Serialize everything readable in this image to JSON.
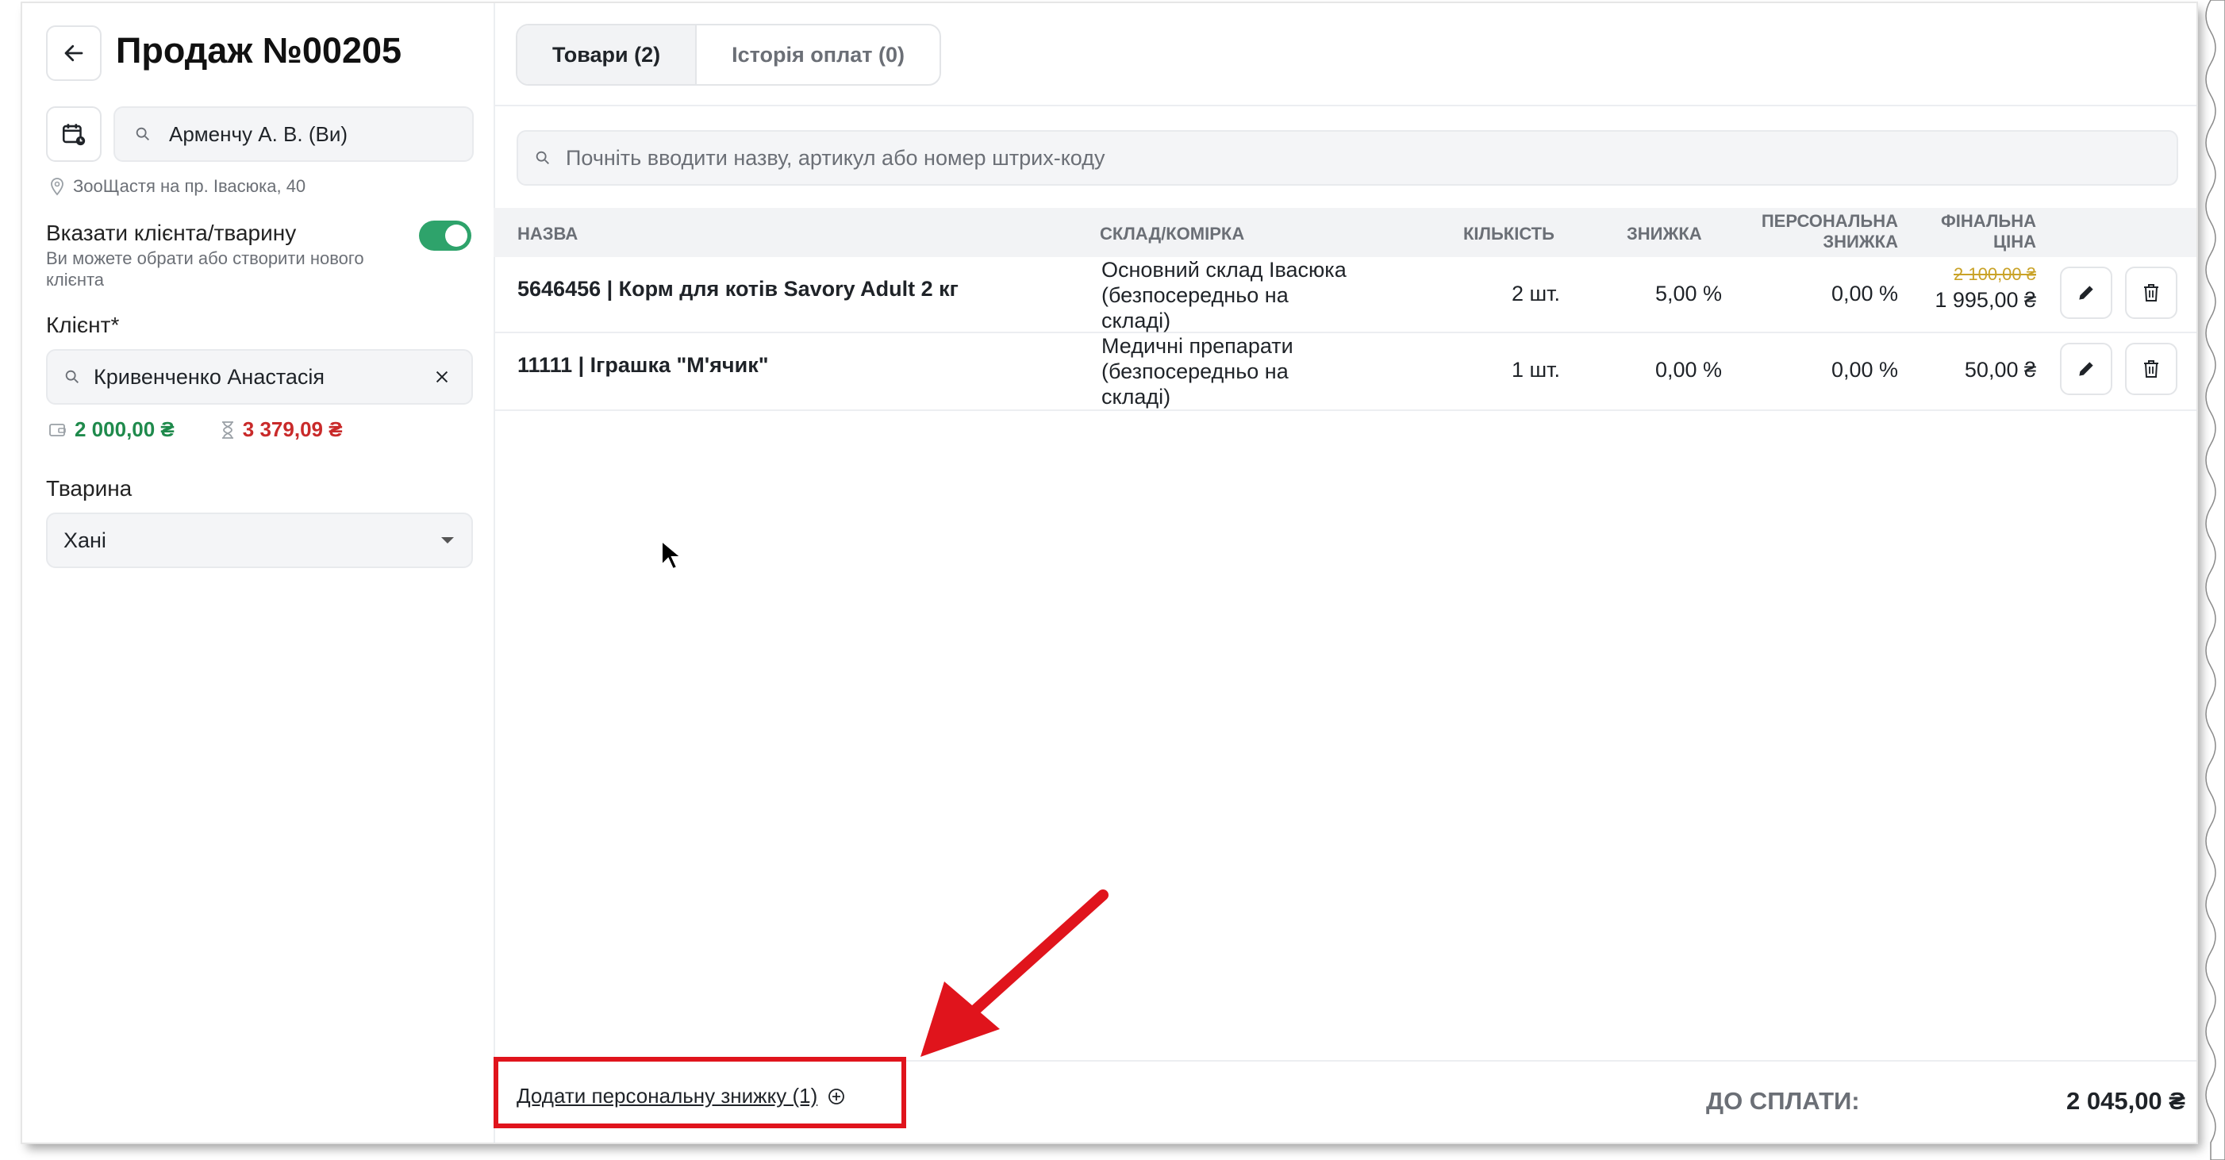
{
  "header": {
    "title": "Продаж №00205"
  },
  "sidebar": {
    "user": "Арменчу А. В. (Ви)",
    "location": "ЗооЩастя на пр. Івасюка, 40",
    "toggle_title": "Вказати клієнта/тварину",
    "toggle_sub": "Ви можете обрати або створити нового клієнта",
    "client_label": "Клієнт*",
    "client_value": "Кривенченко Анастасія",
    "balance_green": "2 000,00 ₴",
    "balance_red": "3 379,09 ₴",
    "pet_label": "Тварина",
    "pet_value": "Хані"
  },
  "tabs": [
    {
      "label": "Товари (2)"
    },
    {
      "label": "Історія оплат (0)"
    }
  ],
  "search": {
    "placeholder": "Почніть вводити назву, артикул або номер штрих-коду"
  },
  "table": {
    "headers": {
      "name": "НАЗВА",
      "warehouse": "СКЛАД/КОМІРКА",
      "qty": "КІЛЬКІСТЬ",
      "discount": "ЗНИЖКА",
      "personal_1": "ПЕРСОНАЛЬНА",
      "personal_2": "ЗНИЖКА",
      "final_1": "ФІНАЛЬНА",
      "final_2": "ЦІНА"
    },
    "rows": [
      {
        "name": "5646456 | Корм для котів Savory Adult 2 кг",
        "wh1": "Основний склад Івасюка",
        "wh2": "(безпосередньо на",
        "wh3": "складі)",
        "qty": "2 шт.",
        "discount": "5,00 %",
        "personal": "0,00 %",
        "old_price": "2 100,00 ₴",
        "final": "1 995,00 ₴"
      },
      {
        "name": "11111 | Іграшка \"М'ячик\"",
        "wh1": "Медичні препарати",
        "wh2": "(безпосередньо на",
        "wh3": "складі)",
        "qty": "1 шт.",
        "discount": "0,00 %",
        "personal": "0,00 %",
        "final": "50,00 ₴"
      }
    ]
  },
  "footer": {
    "add_discount": "Додати персональну знижку (1)",
    "total_label": "ДО СПЛАТИ:",
    "total_value": "2 045,00 ₴"
  },
  "colors": {
    "accent_green": "#2ea36b",
    "balance_green": "#1f8a4c",
    "balance_red": "#c92a2a",
    "annotation_red": "#e0141c"
  }
}
